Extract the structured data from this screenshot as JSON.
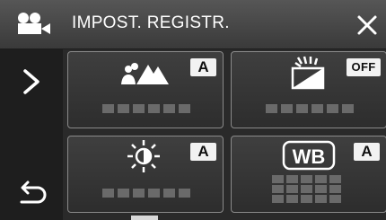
{
  "header": {
    "title": "IMPOST. REGISTR.",
    "mode_icon": "video-camera-icon",
    "close_icon": "close-icon"
  },
  "nav": {
    "next_icon": "chevron-right-icon",
    "back_icon": "return-arrow-icon"
  },
  "tiles": [
    {
      "icon": "scene-landscape-icon",
      "badge": "A"
    },
    {
      "icon": "backlight-compensation-icon",
      "badge": "OFF"
    },
    {
      "icon": "brightness-sun-icon",
      "badge": "A"
    },
    {
      "icon": "white-balance-icon",
      "icon_text": "WB",
      "badge": "A"
    }
  ],
  "colors": {
    "header": "#484848",
    "background": "#2a2a2a",
    "badge": "#f2f2f2",
    "icon": "#ffffff"
  }
}
